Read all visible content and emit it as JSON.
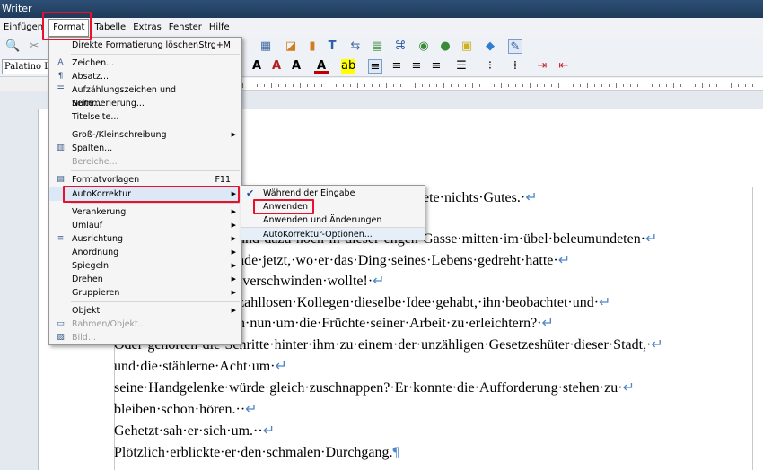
{
  "window": {
    "title": "Writer"
  },
  "menubar": [
    {
      "label": "Einfügen"
    },
    {
      "label": "Format"
    },
    {
      "label": "Tabelle"
    },
    {
      "label": "Extras"
    },
    {
      "label": "Fenster"
    },
    {
      "label": "Hilfe"
    }
  ],
  "toolbar": {
    "font_name": "Palatino Lin"
  },
  "format_menu": [
    {
      "label": "Direkte Formatierung löschen",
      "shortcut": "Strg+M",
      "icon": "",
      "arrow": false,
      "disabled": false
    },
    {
      "label": "Zeichen...",
      "icon": "character-icon"
    },
    {
      "label": "Absatz...",
      "icon": "paragraph-icon"
    },
    {
      "label": "Aufzählungszeichen und Nummerierung...",
      "icon": "bullets-icon"
    },
    {
      "label": "Seite...",
      "icon": ""
    },
    {
      "label": "Titelseite...",
      "icon": ""
    },
    {
      "label": "Groß-/Kleinschreibung",
      "arrow": true
    },
    {
      "label": "Spalten...",
      "icon": "columns-icon"
    },
    {
      "label": "Bereiche...",
      "disabled": true
    },
    {
      "label": "Formatvorlagen",
      "shortcut": "F11",
      "icon": "styles-icon"
    },
    {
      "label": "AutoKorrektur",
      "arrow": true
    },
    {
      "label": "Verankerung",
      "arrow": true
    },
    {
      "label": "Umlauf",
      "arrow": true
    },
    {
      "label": "Ausrichtung",
      "arrow": true,
      "icon": "align-icon"
    },
    {
      "label": "Anordnung",
      "arrow": true
    },
    {
      "label": "Spiegeln",
      "arrow": true
    },
    {
      "label": "Drehen",
      "arrow": true
    },
    {
      "label": "Gruppieren",
      "arrow": true
    },
    {
      "label": "Objekt",
      "arrow": true
    },
    {
      "label": "Rahmen/Objekt...",
      "disabled": true,
      "icon": "frame-icon"
    },
    {
      "label": "Bild...",
      "disabled": true,
      "icon": "image-icon"
    }
  ],
  "autokorrektur_submenu": [
    {
      "label": "Während der Eingabe",
      "checked": true
    },
    {
      "label": "Anwenden"
    },
    {
      "label": "Anwenden und Änderungen bearbeiten"
    },
    {
      "label": "AutoKorrektur-Optionen..."
    }
  ],
  "document": {
    "lines": [
      "ete·nichts·Gutes.·",
      "und·dazu·noch·in·dieser·engen·Gasse·mitten·im·übel·beleumundeten·",
      "ade·jetzt,·wo·er·das·Ding·seines·Lebens·gedreht·hatte·",
      "·verschwinden·wollte!·",
      "zahllosen·Kollegen·dieselbe·Idee·gehabt,·ihn·beobachtet·und·",
      "n·nun·um·die·Früchte·seiner·Arbeit·zu·erleichtern?·",
      "Oder·gehörten·die·Schritte·hinter·ihm·zu·einem·der·unzähligen·Gesetzeshüter·dieser·Stadt,·",
      "und·die·stählerne·Acht·um·",
      "seine·Handgelenke·würde·gleich·zuschnappen?·Er·konnte·die·Aufforderung·stehen·zu·",
      "bleiben·schon·hören.··",
      "Gehetzt·sah·er·sich·um.··",
      "Plötzlich·erblickte·er·den·schmalen·Durchgang."
    ],
    "line_break_mark": "↵",
    "paragraph_mark": "¶"
  }
}
